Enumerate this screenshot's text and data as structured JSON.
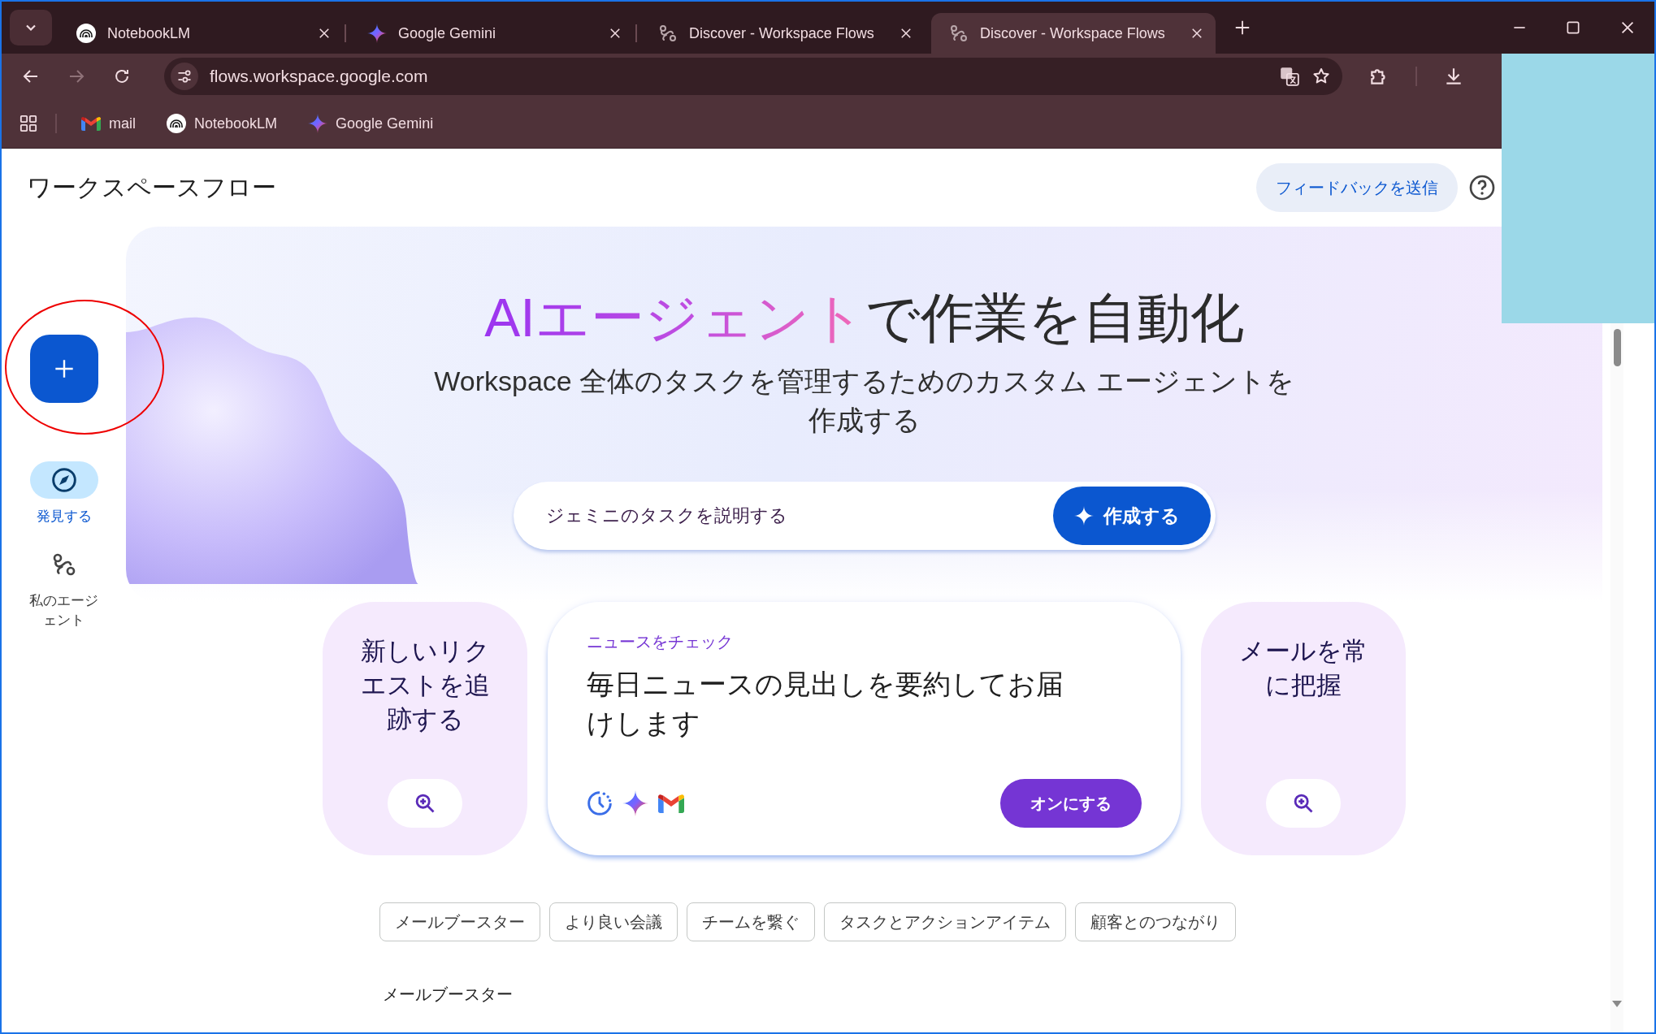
{
  "browser": {
    "tabs": [
      {
        "title": "NotebookLM",
        "selected": false
      },
      {
        "title": "Google Gemini",
        "selected": false
      },
      {
        "title": "Discover - Workspace Flows",
        "selected": false
      },
      {
        "title": "Discover - Workspace Flows",
        "selected": true
      }
    ],
    "address": "flows.workspace.google.com",
    "bookmarks": [
      {
        "label": "mail"
      },
      {
        "label": "NotebookLM"
      },
      {
        "label": "Google Gemini"
      }
    ]
  },
  "app": {
    "title": "ワークスペースフロー",
    "feedback_button": "フィードバックを送信"
  },
  "sidebar": {
    "items": [
      {
        "label": "発見する",
        "selected": true
      },
      {
        "label": "私のエージェント",
        "selected": false
      }
    ]
  },
  "hero": {
    "headline": {
      "accent": "AIエージェント",
      "rest": "で作業を自動化"
    },
    "subtitle": "Workspace 全体のタスクを管理するためのカスタム エージェントを作成する",
    "prompt": {
      "placeholder": "ジェミニのタスクを説明する",
      "button": "作成する"
    }
  },
  "cards": [
    {
      "kind": "compact",
      "title": "新しいリクエストを追跡する"
    },
    {
      "kind": "featured",
      "category": "ニュースをチェック",
      "title": "毎日ニュースの見出しを要約してお届けします",
      "button": "オンにする"
    },
    {
      "kind": "compact",
      "title": "メールを常に把握"
    }
  ],
  "chips": [
    {
      "label": "メールブースター"
    },
    {
      "label": "より良い会議"
    },
    {
      "label": "チームを繋ぐ"
    },
    {
      "label": "タスクとアクションアイテム"
    },
    {
      "label": "顧客とのつながり"
    }
  ],
  "section_heading": "メールブースター"
}
